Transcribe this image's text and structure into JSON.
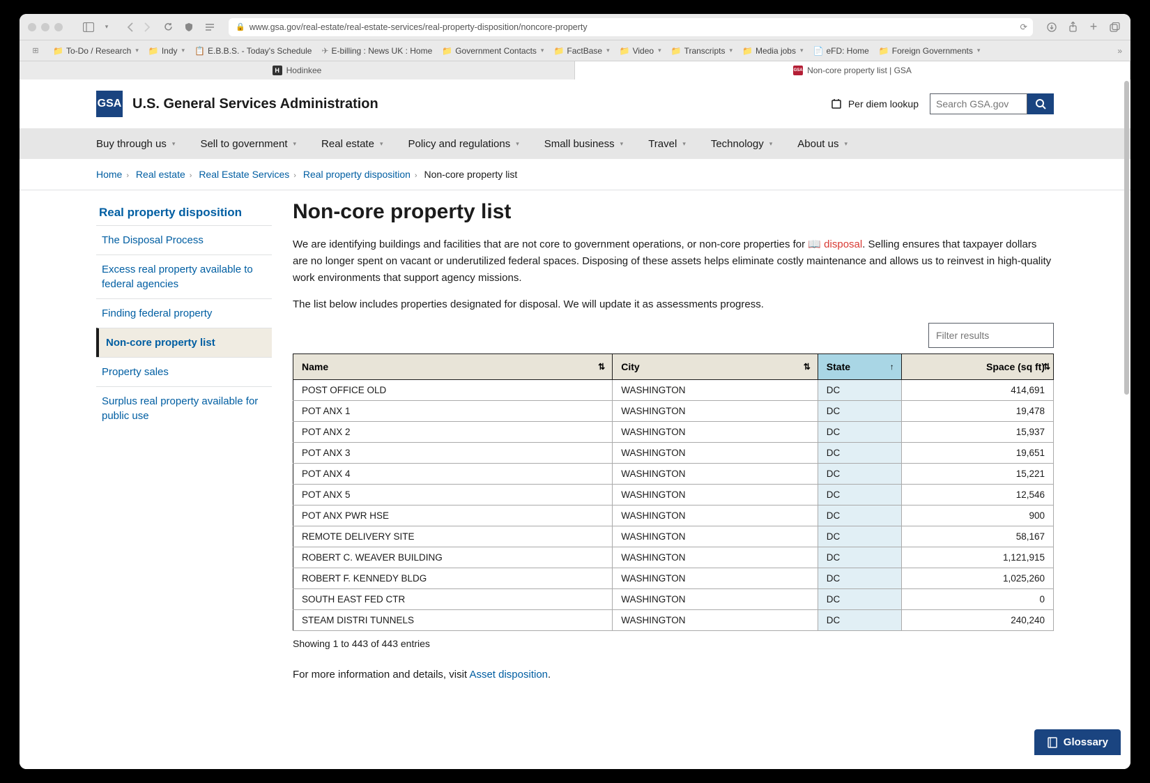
{
  "browser": {
    "url": "www.gsa.gov/real-estate/real-estate-services/real-property-disposition/noncore-property",
    "bookmarks": [
      "To-Do / Research",
      "Indy",
      "E.B.B.S. - Today's Schedule",
      "E-billing : News UK : Home",
      "Government Contacts",
      "FactBase",
      "Video",
      "Transcripts",
      "Media jobs",
      "eFD: Home",
      "Foreign Governments"
    ],
    "tabs": [
      {
        "title": "Hodinkee",
        "fav": "H"
      },
      {
        "title": "Non-core property list | GSA",
        "fav": "GSA"
      }
    ]
  },
  "header": {
    "org": "U.S. General Services Administration",
    "logo": "GSA",
    "perdiem": "Per diem lookup",
    "search_placeholder": "Search GSA.gov"
  },
  "nav": [
    "Buy through us",
    "Sell to government",
    "Real estate",
    "Policy and regulations",
    "Small business",
    "Travel",
    "Technology",
    "About us"
  ],
  "breadcrumbs": {
    "links": [
      "Home",
      "Real estate",
      "Real Estate Services",
      "Real property disposition"
    ],
    "current": "Non-core property list"
  },
  "sidebar": {
    "title": "Real property disposition",
    "items": [
      "The Disposal Process",
      "Excess real property available to federal agencies",
      "Finding federal property",
      "Non-core property list",
      "Property sales",
      "Surplus real property available for public use"
    ],
    "active_index": 3
  },
  "main": {
    "title": "Non-core property list",
    "intro1_pre": "We are identifying buildings and facilities that are not core to government operations, or non-core properties for ",
    "intro1_link": "disposal",
    "intro1_post": ". Selling ensures that taxpayer dollars are no longer spent on vacant or underutilized federal spaces. Disposing of these assets helps eliminate costly maintenance and allows us to reinvest in high-quality work environments that support agency missions.",
    "intro2": "The list below includes properties designated for disposal. We will update it as assessments progress.",
    "filter_placeholder": "Filter results",
    "columns": [
      "Name",
      "City",
      "State",
      "Space (sq ft)"
    ],
    "rows": [
      {
        "name": "POST OFFICE OLD",
        "city": "WASHINGTON",
        "state": "DC",
        "space": "414,691"
      },
      {
        "name": "POT ANX 1",
        "city": "WASHINGTON",
        "state": "DC",
        "space": "19,478"
      },
      {
        "name": "POT ANX 2",
        "city": "WASHINGTON",
        "state": "DC",
        "space": "15,937"
      },
      {
        "name": "POT ANX 3",
        "city": "WASHINGTON",
        "state": "DC",
        "space": "19,651"
      },
      {
        "name": "POT ANX 4",
        "city": "WASHINGTON",
        "state": "DC",
        "space": "15,221"
      },
      {
        "name": "POT ANX 5",
        "city": "WASHINGTON",
        "state": "DC",
        "space": "12,546"
      },
      {
        "name": "POT ANX PWR HSE",
        "city": "WASHINGTON",
        "state": "DC",
        "space": "900"
      },
      {
        "name": "REMOTE DELIVERY SITE",
        "city": "WASHINGTON",
        "state": "DC",
        "space": "58,167"
      },
      {
        "name": "ROBERT C. WEAVER BUILDING",
        "city": "WASHINGTON",
        "state": "DC",
        "space": "1,121,915"
      },
      {
        "name": "ROBERT F. KENNEDY BLDG",
        "city": "WASHINGTON",
        "state": "DC",
        "space": "1,025,260"
      },
      {
        "name": "SOUTH EAST FED CTR",
        "city": "WASHINGTON",
        "state": "DC",
        "space": "0"
      },
      {
        "name": "STEAM DISTRI TUNNELS",
        "city": "WASHINGTON",
        "state": "DC",
        "space": "240,240"
      }
    ],
    "showing": "Showing 1 to 443 of 443 entries",
    "more_info_pre": "For more information and details, visit ",
    "more_info_link": "Asset disposition",
    "more_info_post": "."
  },
  "glossary": "Glossary"
}
